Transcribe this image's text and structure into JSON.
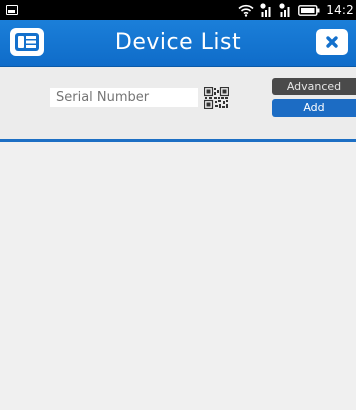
{
  "status_bar": {
    "time": "14:2",
    "icons": [
      "image-icon",
      "wifi-icon",
      "signal-icon",
      "signal-icon",
      "battery-icon"
    ]
  },
  "title_bar": {
    "title": "Device List",
    "menu_icon": "menu-icon",
    "close_icon": "close-icon",
    "color": "#1677d2"
  },
  "form": {
    "serial_placeholder": "Serial Number",
    "qr_icon": "qr-code-icon",
    "advanced_label": "Advanced",
    "add_label": "Add"
  },
  "colors": {
    "accent": "#1c6cc4",
    "advanced_button": "#4a4a4a",
    "background": "#f0f0f0"
  }
}
